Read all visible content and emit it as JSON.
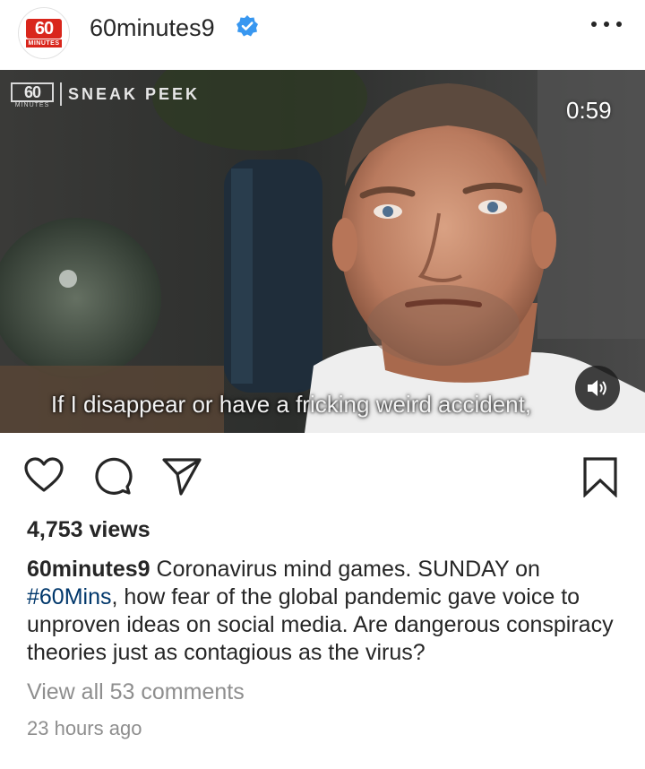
{
  "post": {
    "username": "60minutes9",
    "verified": true,
    "avatar_logo_top": "60",
    "avatar_logo_bottom": "MINUTES",
    "more_icon": "more-horizontal-icon"
  },
  "video": {
    "brand_logo": "60",
    "brand_logo_sub": "MINUTES",
    "brand_label": "SNEAK PEEK",
    "duration": "0:59",
    "subtitle": "If I disappear or have a fricking weird accident,",
    "sound_icon": "speaker-icon"
  },
  "actions": {
    "like_icon": "heart-icon",
    "comment_icon": "comment-icon",
    "share_icon": "send-icon",
    "save_icon": "bookmark-icon"
  },
  "stats": {
    "views": "4,753 views"
  },
  "caption": {
    "user": "60minutes9",
    "text_before": " Coronavirus mind games. SUNDAY on ",
    "hashtag": "#60Mins",
    "text_after": ", how fear of the global pandemic gave voice to unproven ideas on social media. Are dangerous conspiracy theories just as contagious as the virus?"
  },
  "comments": {
    "view_all": "View all 53 comments"
  },
  "time": {
    "posted": "23 hours ago"
  },
  "colors": {
    "brand_red": "#d9261c",
    "verified_blue": "#3897f0",
    "hashtag_blue": "#00376b",
    "muted_gray": "#8e8e8e"
  }
}
